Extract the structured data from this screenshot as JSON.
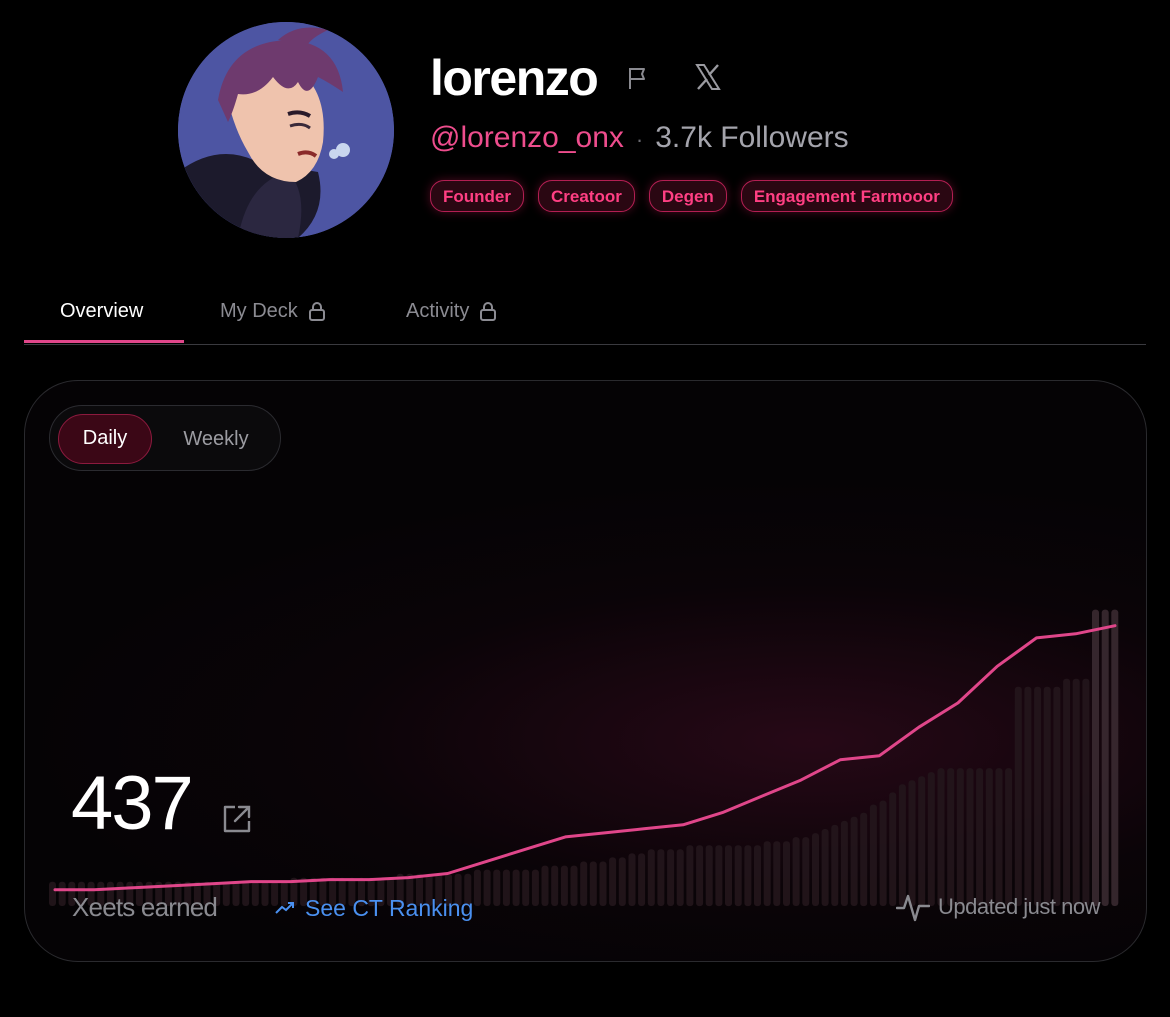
{
  "profile": {
    "name": "lorenzo",
    "handle": "@lorenzo_onx",
    "separator": "·",
    "followers": "3.7k Followers",
    "icons": [
      "flag-icon",
      "x-logo-icon"
    ],
    "tags": [
      "Founder",
      "Creatoor",
      "Degen",
      "Engagement Farmooor"
    ]
  },
  "tabs": [
    {
      "label": "Overview",
      "active": true,
      "locked": false
    },
    {
      "label": "My Deck",
      "active": false,
      "locked": true
    },
    {
      "label": "Activity",
      "active": false,
      "locked": true
    }
  ],
  "card": {
    "toggle": {
      "daily": "Daily",
      "weekly": "Weekly",
      "selected": "Daily"
    },
    "value": "437",
    "value_label": "Xeets earned",
    "ranking_link": "See CT Ranking",
    "updated": "Updated just now"
  },
  "colors": {
    "accent": "#ee4d8d",
    "line": "#e0468a",
    "link": "#4a90f0",
    "tag_text": "#ff3f83",
    "background": "#000000"
  },
  "chart_data": {
    "type": "area",
    "title": "",
    "xlabel": "",
    "ylabel": "",
    "line": [
      4,
      4,
      4.5,
      5,
      5.5,
      6,
      6,
      6.5,
      6.5,
      7,
      8,
      11,
      14,
      17,
      18,
      19,
      20,
      23,
      27,
      31,
      36,
      37,
      44,
      50,
      59,
      66,
      67,
      69
    ],
    "bars": [
      3,
      3,
      3,
      3,
      3,
      3,
      3,
      3,
      3,
      3,
      3,
      3,
      3,
      3,
      3,
      3,
      3,
      3,
      3,
      3,
      3,
      3,
      3,
      3,
      3,
      4,
      4,
      4,
      4,
      4,
      4,
      4,
      4,
      4,
      4,
      4,
      5,
      5,
      5,
      5,
      5,
      5,
      5,
      5,
      6,
      6,
      6,
      6,
      6,
      6,
      6,
      7,
      7,
      7,
      7,
      8,
      8,
      8,
      9,
      9,
      10,
      10,
      11,
      11,
      11,
      11,
      12,
      12,
      12,
      12,
      12,
      12,
      12,
      12,
      13,
      13,
      13,
      14,
      14,
      15,
      16,
      17,
      18,
      19,
      20,
      22,
      23,
      25,
      27,
      28,
      29,
      30,
      31,
      31,
      31,
      31,
      31,
      31,
      31,
      31,
      51,
      51,
      51,
      51,
      51,
      53,
      53,
      53,
      70,
      70,
      70
    ],
    "y_range": [
      0,
      80
    ],
    "grid": false
  }
}
